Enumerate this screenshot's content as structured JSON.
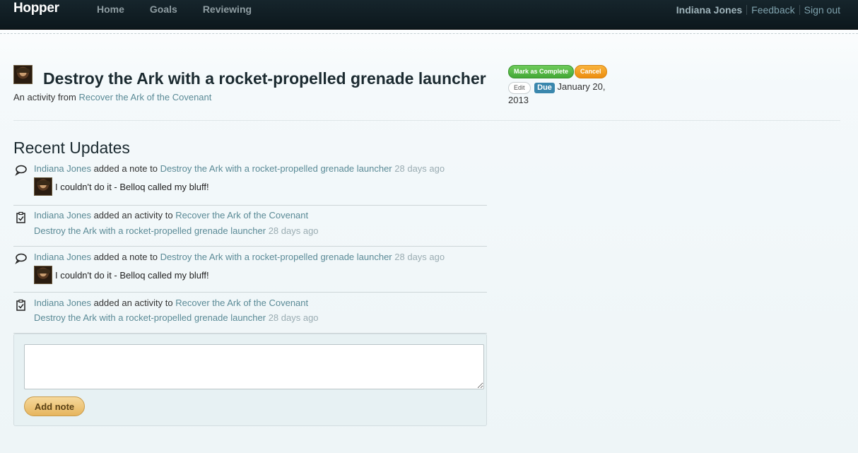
{
  "nav": {
    "brand": "Hopper",
    "links": [
      "Home",
      "Goals",
      "Reviewing"
    ],
    "user_name": "Indiana Jones",
    "feedback": "Feedback",
    "signout": "Sign out"
  },
  "activity": {
    "title": "Destroy the Ark with a rocket-propelled grenade launcher",
    "from_prefix": "An activity from",
    "goal": "Recover the Ark of the Covenant",
    "mark_complete": "Mark as Complete",
    "cancel": "Cancel",
    "edit": "Edit",
    "due_badge": "Due",
    "due_date": "January 20, 2013"
  },
  "updates": {
    "heading": "Recent Updates",
    "items": [
      {
        "type": "note",
        "icon": "speech-bubble-icon",
        "user": "Indiana Jones",
        "verb": "added a note to",
        "target": "Destroy the Ark with a rocket-propelled grenade launcher",
        "ago": "28 days ago",
        "body": "I couldn't do it - Belloq called my bluff!"
      },
      {
        "type": "activity",
        "icon": "clipboard-check-icon",
        "user": "Indiana Jones",
        "verb": "added an activity to",
        "target": "Recover the Ark of the Covenant",
        "activity": "Destroy the Ark with a rocket-propelled grenade launcher",
        "ago": "28 days ago"
      },
      {
        "type": "note",
        "icon": "speech-bubble-icon",
        "user": "Indiana Jones",
        "verb": "added a note to",
        "target": "Destroy the Ark with a rocket-propelled grenade launcher",
        "ago": "28 days ago",
        "body": "I couldn't do it - Belloq called my bluff!"
      },
      {
        "type": "activity",
        "icon": "clipboard-check-icon",
        "user": "Indiana Jones",
        "verb": "added an activity to",
        "target": "Recover the Ark of the Covenant",
        "activity": "Destroy the Ark with a rocket-propelled grenade launcher",
        "ago": "28 days ago"
      }
    ]
  },
  "form": {
    "textarea_value": "",
    "add_note": "Add note"
  }
}
